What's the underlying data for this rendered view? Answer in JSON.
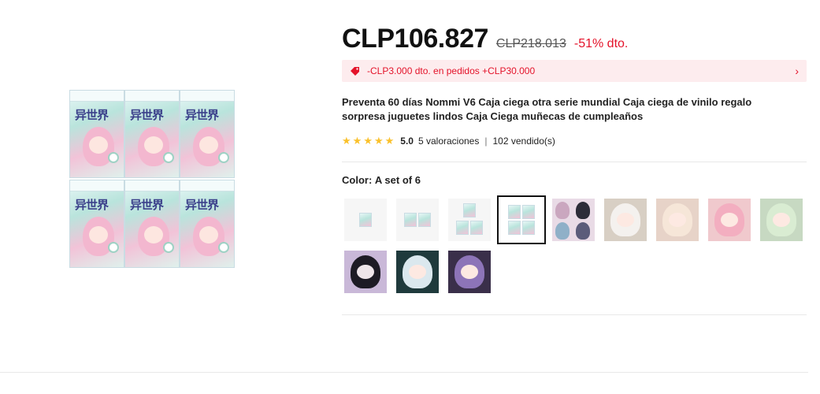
{
  "product": {
    "price": "CLP106.827",
    "old_price": "CLP218.013",
    "discount": "-51% dto.",
    "coupon_text": "-CLP3.000 dto. en pedidos +CLP30.000",
    "title": "Preventa 60 días Nommi V6 Caja ciega otra serie mundial Caja ciega de vinilo regalo sorpresa juguetes lindos Caja Ciega muñecas de cumpleaños",
    "rating": {
      "score": "5.0",
      "reviews": "5 valoraciones",
      "separator": "|",
      "sold": "102 vendido(s)",
      "stars": 5
    },
    "color": {
      "label": "Color:",
      "selected_value": "A set of 6"
    },
    "box_logo": "异世界"
  },
  "colors": {
    "accent_red": "#e4132a",
    "coupon_bg": "#fdecee",
    "star": "#fac12c"
  },
  "icons": [
    "tag-icon",
    "chevron-right-icon",
    "star-icon"
  ]
}
